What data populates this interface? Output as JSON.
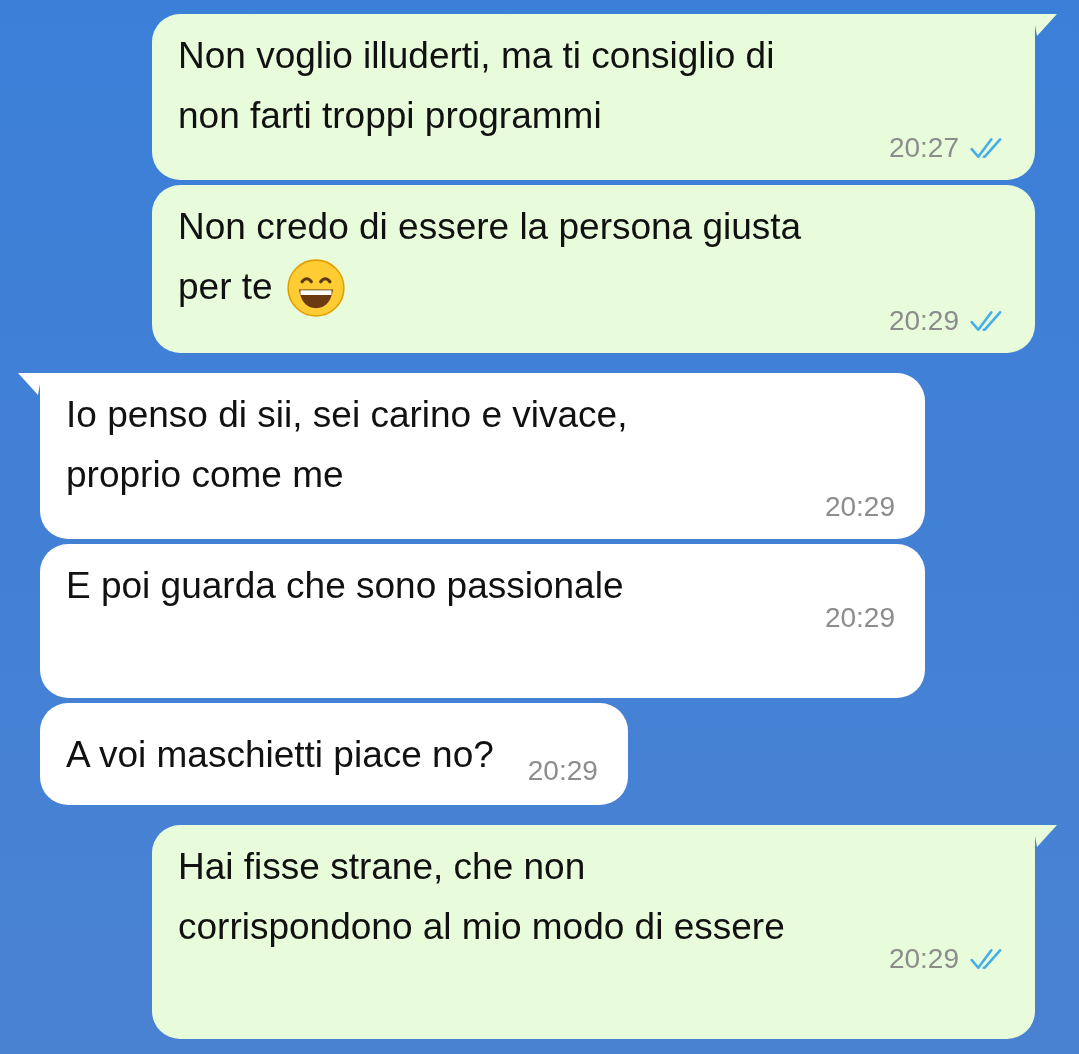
{
  "messages": [
    {
      "kind": "outgoing",
      "tail": true,
      "text": "Non voglio illuderti, ma ti consiglio di\nnon farti troppi programmi",
      "time": "20:27",
      "read": true
    },
    {
      "kind": "outgoing",
      "tail": false,
      "text": "Non credo di essere la persona giusta\nper te",
      "emoji": true,
      "time": "20:29",
      "read": true
    },
    {
      "kind": "incoming",
      "tail": true,
      "text": "Io penso di sii, sei carino e vivace,\nproprio come me",
      "time": "20:29"
    },
    {
      "kind": "incoming",
      "tail": false,
      "text": "E poi guarda che sono passionale",
      "time": "20:29",
      "tall": true
    },
    {
      "kind": "incoming",
      "tail": false,
      "text": "A voi maschietti piace no?",
      "time": "20:29",
      "inline": true
    },
    {
      "kind": "outgoing",
      "tail": true,
      "text": "Hai fisse strane, che non\ncorrispondono al mio modo di essere",
      "time": "20:29",
      "read": true,
      "tall": true
    }
  ]
}
